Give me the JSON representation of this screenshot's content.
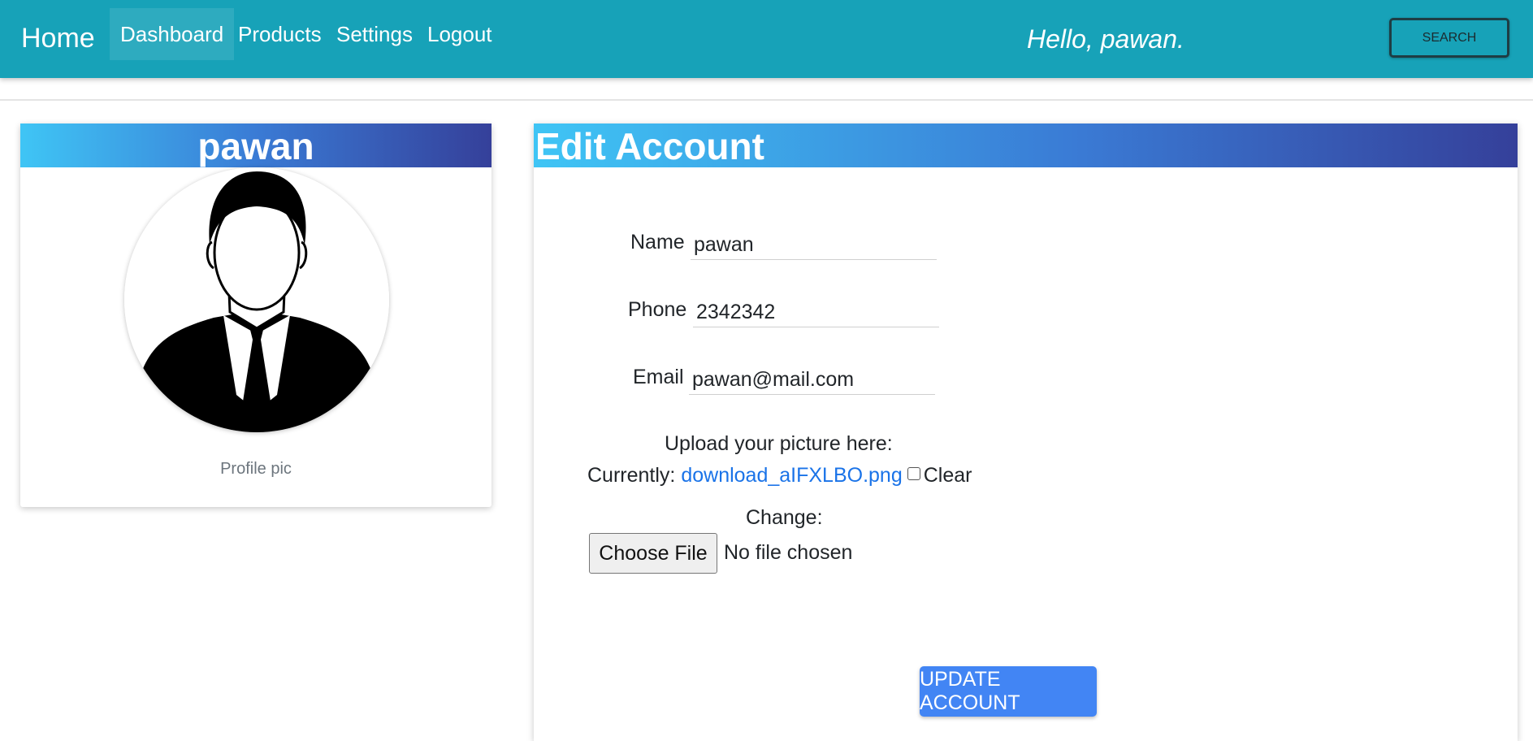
{
  "nav": {
    "brand": "Home",
    "links": [
      "Dashboard",
      "Products",
      "Settings",
      "Logout"
    ],
    "active": "Dashboard",
    "greeting": "Hello, pawan.",
    "search_label": "SEARCH"
  },
  "profile": {
    "name": "pawan",
    "caption": "Profile pic"
  },
  "edit": {
    "title": "Edit Account",
    "name_label": "Name",
    "name_value": "pawan",
    "phone_label": "Phone",
    "phone_value": "2342342",
    "email_label": "Email",
    "email_value": "pawan@mail.com",
    "upload_label": "Upload your picture here:",
    "currently_label": "Currently:",
    "current_file": "download_aIFXLBO.png",
    "clear_label": "Clear",
    "change_label": "Change:",
    "choose_file_label": "Choose File",
    "no_file_label": "No file chosen",
    "update_label": "UPDATE ACCOUNT"
  },
  "colors": {
    "navbar": "#17a2b8",
    "header_gradient_start": "#3fc5f5",
    "header_gradient_end": "#35409a",
    "button_primary": "#4285f4",
    "link": "#1a73e8"
  }
}
